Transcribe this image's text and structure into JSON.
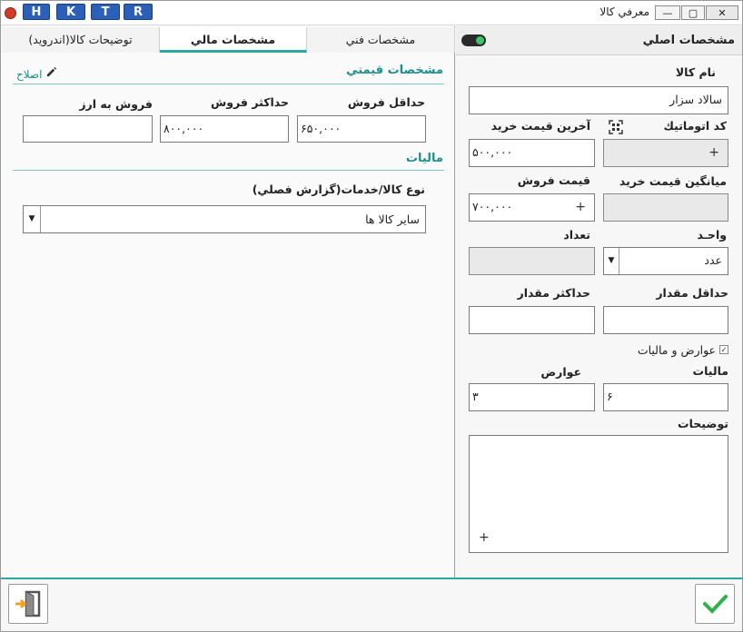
{
  "window": {
    "title": "معرفي كالا",
    "title_buttons": [
      "H",
      "K",
      "T",
      "R"
    ],
    "controls": {
      "minimize": "—",
      "maximize": "▢",
      "close": "✕"
    }
  },
  "left_panel": {
    "tabs": [
      {
        "label": "توضيحات كالا(اندرويد)"
      },
      {
        "label": "مشخصات مالي"
      },
      {
        "label": "مشخصات فني"
      }
    ],
    "pricing": {
      "title": "مشخصات قيمتي",
      "edit_label": "اصلاح",
      "min_sale_label": "حداقل فروش",
      "min_sale_value": "۶۵۰,۰۰۰",
      "max_sale_label": "حداكثر فروش",
      "max_sale_value": "۸۰۰,۰۰۰",
      "fx_sale_label": "فروش به ارز",
      "fx_sale_value": ""
    },
    "taxes": {
      "title": "ماليات",
      "type_label": "نوع كالا/خدمات(گزارش فصلي)",
      "type_value": "ساير كالا ها"
    }
  },
  "right_panel": {
    "title": "مشخصات اصلي",
    "toggle_on": true,
    "item_name_label": "نام كالا",
    "item_name_value": "سالاد سزار",
    "auto_code_label": "كد اتوماتيك",
    "auto_code_value": "",
    "last_purchase_label": "آخرين قيمت خريد",
    "last_purchase_value": "۵۰۰,۰۰۰",
    "avg_purchase_label": "ميانگين قيمت خريد",
    "avg_purchase_value": "",
    "sale_price_label": "قيمت فروش",
    "sale_price_value": "۷۰۰,۰۰۰",
    "unit_label": "واحـد",
    "unit_value": "عدد",
    "count_label": "تعداد",
    "count_value": "",
    "min_qty_label": "حداقل مقدار",
    "min_qty_value": "",
    "max_qty_label": "حداكثر مقدار",
    "max_qty_value": "",
    "duties_checkbox_label": "عوارض و ماليات",
    "duties_checked": true,
    "tax_label": "ماليات",
    "tax_value": "۶",
    "duty_label": "عوارض",
    "duty_value": "۳",
    "notes_label": "توضيحات",
    "notes_value": ""
  }
}
